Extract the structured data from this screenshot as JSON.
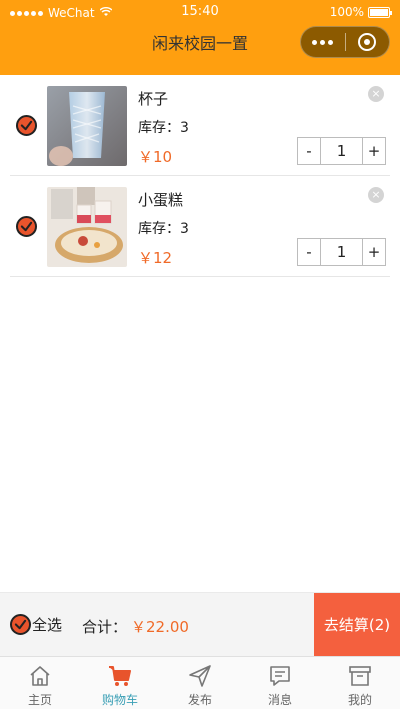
{
  "status_bar": {
    "carrier": "WeChat",
    "time": "15:40",
    "battery_text": "100%",
    "battery_level": 1.0
  },
  "nav": {
    "title": "闲来校园一置"
  },
  "cart": {
    "items": [
      {
        "name": "杯子",
        "stock_label": "库存：",
        "stock": "3",
        "price": "￥10",
        "quantity": "1",
        "checked": true
      },
      {
        "name": "小蛋糕",
        "stock_label": "库存：",
        "stock": "3",
        "price": "￥12",
        "quantity": "1",
        "checked": true
      }
    ],
    "minus_label": "-",
    "plus_label": "+",
    "remove_label": "×"
  },
  "checkout": {
    "select_all_label": "全选",
    "total_label": "合计：",
    "total_amount": "￥22.00",
    "settle_label": "去结算(2)"
  },
  "tabbar": {
    "items": [
      {
        "label": "主页",
        "icon": "home-icon",
        "active": false
      },
      {
        "label": "购物车",
        "icon": "cart-icon",
        "active": true
      },
      {
        "label": "发布",
        "icon": "send-icon",
        "active": false
      },
      {
        "label": "消息",
        "icon": "message-icon",
        "active": false
      },
      {
        "label": "我的",
        "icon": "archive-icon",
        "active": false
      }
    ]
  },
  "colors": {
    "nav_bg": "#ff9f0f",
    "accent": "#f06a28",
    "settle_bg": "#f4603e",
    "active_tab": "#3a9fb5"
  }
}
